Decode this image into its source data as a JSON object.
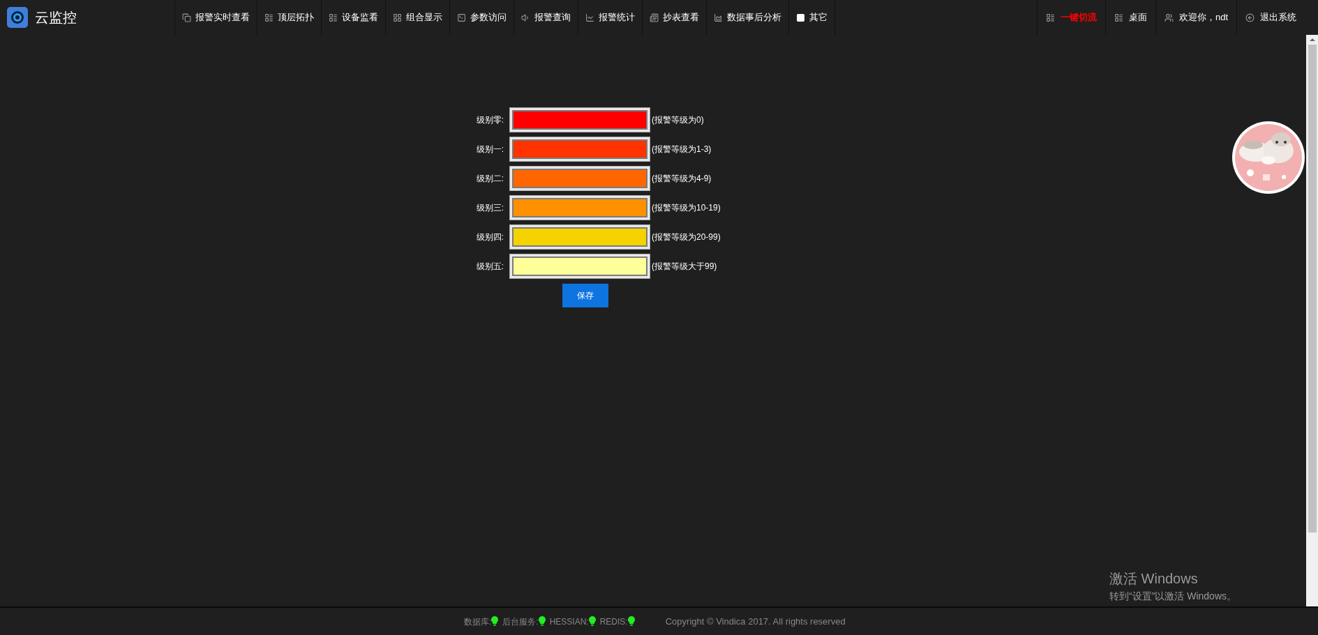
{
  "app": {
    "title": "云监控"
  },
  "nav": [
    {
      "label": "报警实时查看"
    },
    {
      "label": "顶层拓扑"
    },
    {
      "label": "设备监看"
    },
    {
      "label": "组合显示"
    },
    {
      "label": "参数访问"
    },
    {
      "label": "报警查询"
    },
    {
      "label": "报警统计"
    },
    {
      "label": "抄表查看"
    },
    {
      "label": "数据事后分析"
    },
    {
      "label": "其它"
    }
  ],
  "nav_right": [
    {
      "label": "一键切流",
      "highlighted": true
    },
    {
      "label": "桌面",
      "highlighted": false
    },
    {
      "label": "欢迎你，ndt",
      "highlighted": false
    },
    {
      "label": "退出系统",
      "highlighted": false
    }
  ],
  "levels": [
    {
      "label": "级别零:",
      "color": "#ff0000",
      "note": "(报警等级为0)"
    },
    {
      "label": "级别一:",
      "color": "#ff3300",
      "note": "(报警等级为1-3)"
    },
    {
      "label": "级别二:",
      "color": "#ff6600",
      "note": "(报警等级为4-9)"
    },
    {
      "label": "级别三:",
      "color": "#ff9100",
      "note": "(报警等级为10-19)"
    },
    {
      "label": "级别四:",
      "color": "#f5d300",
      "note": "(报警等级为20-99)"
    },
    {
      "label": "级别五:",
      "color": "#ffff99",
      "note": "(报警等级大于99)"
    }
  ],
  "save_button": "保存",
  "status": [
    {
      "label": "数据库:",
      "on": true
    },
    {
      "label": "后台服务:",
      "on": true
    },
    {
      "label": "HESSIAN:",
      "on": true
    },
    {
      "label": "REDIS:",
      "on": true
    }
  ],
  "copyright": "Copyright © Vindica 2017. All rights reserved",
  "os_notice": {
    "title": "激活 Windows",
    "subtitle": "转到“设置”以激活 Windows。"
  }
}
